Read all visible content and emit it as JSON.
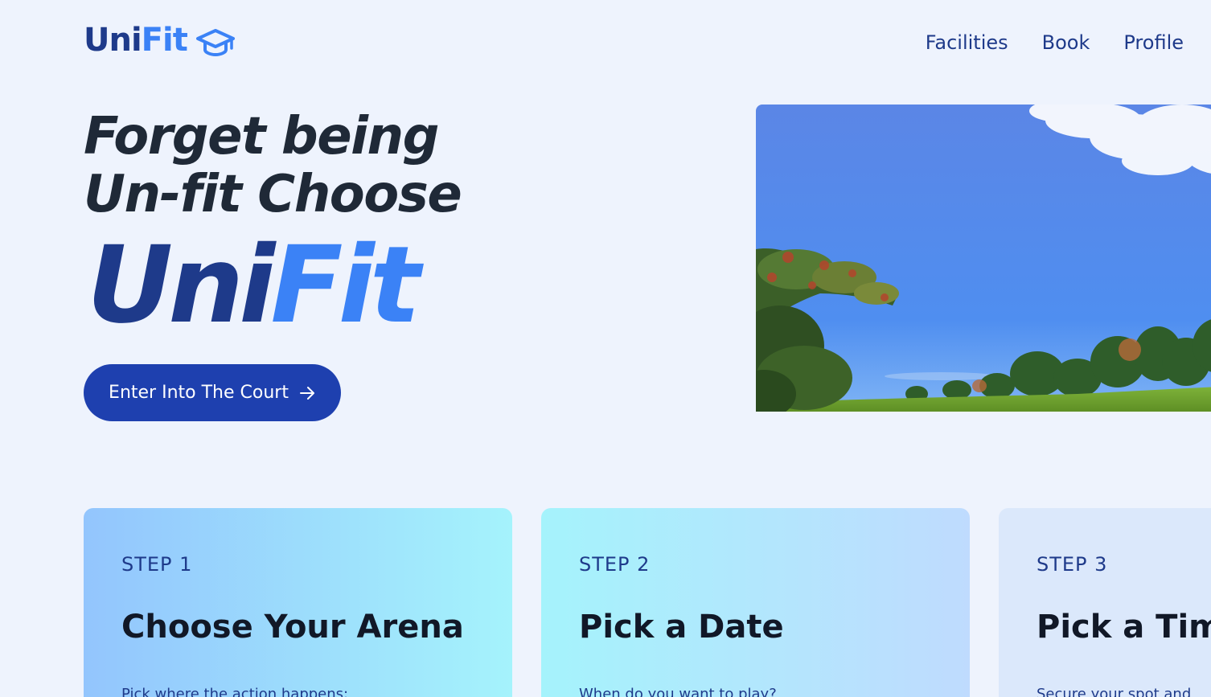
{
  "header": {
    "logo": {
      "uni": "Uni",
      "fit": "Fit",
      "icon": "graduation-cap-icon"
    },
    "nav": [
      {
        "label": "Facilities"
      },
      {
        "label": "Book"
      },
      {
        "label": "Profile"
      }
    ]
  },
  "hero": {
    "title_line1": "Forget being",
    "title_line2": "Un-fit Choose",
    "brand_uni": "Uni",
    "brand_fit": "Fit",
    "cta_label": "Enter Into The Court",
    "cta_icon": "arrow-right-icon",
    "image": "campus-field-photo"
  },
  "steps": [
    {
      "label": "STEP 1",
      "title": "Choose Your Arena",
      "desc": "Pick where the action happens:"
    },
    {
      "label": "STEP 2",
      "title": "Pick a Date",
      "desc": "When do you want to play?"
    },
    {
      "label": "STEP 3",
      "title": "Pick a Tim",
      "desc": "Secure your spot and"
    }
  ],
  "colors": {
    "background": "#eef3fd",
    "brand_dark": "#1e3a8a",
    "brand_light": "#3b82f6",
    "button": "#1e40af"
  }
}
